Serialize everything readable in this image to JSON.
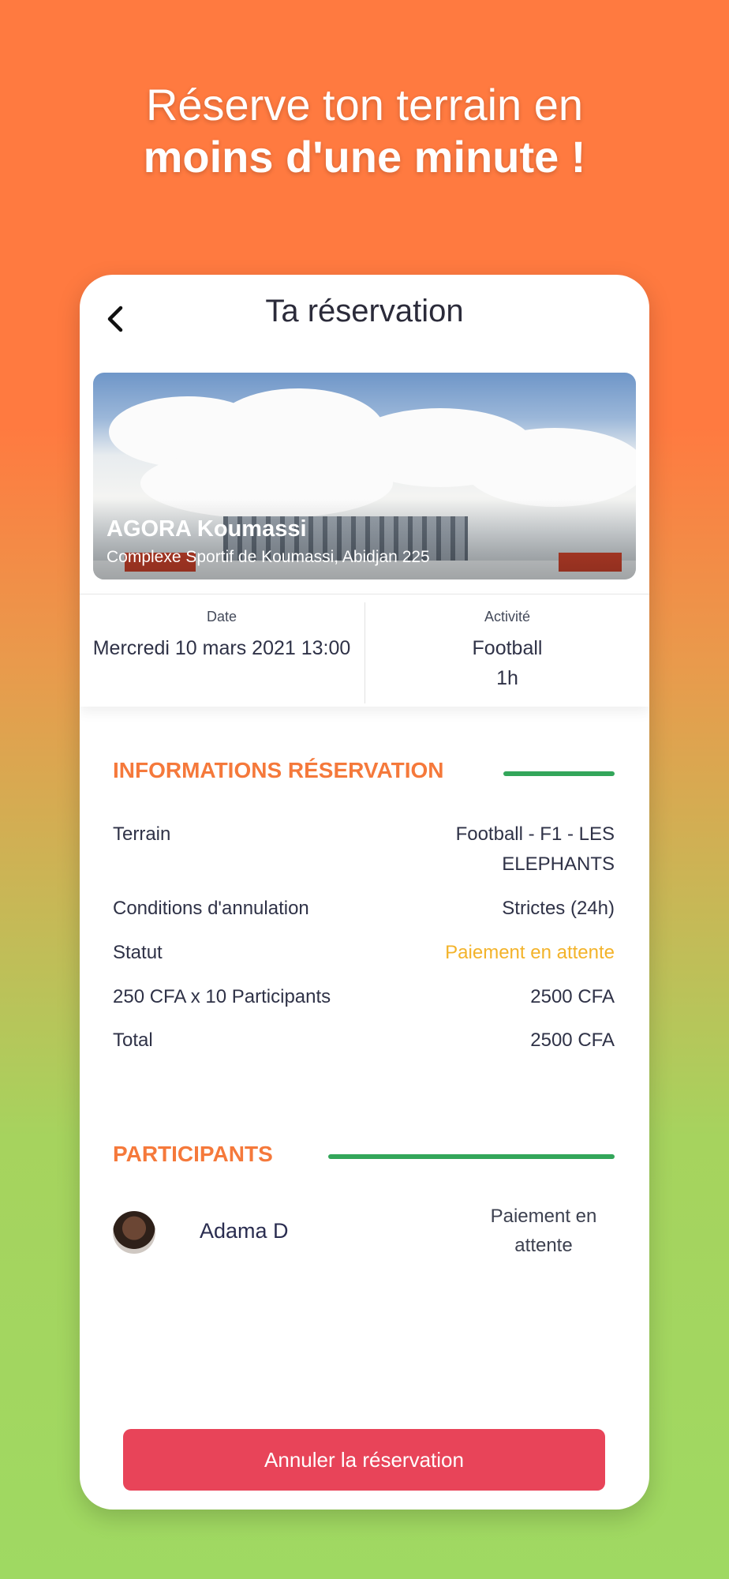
{
  "promo": {
    "line1": "Réserve ton terrain en",
    "line2": "moins d'une minute !"
  },
  "header": {
    "title": "Ta réservation",
    "back_icon": "chevron-left-icon"
  },
  "venue": {
    "name": "AGORA Koumassi",
    "address": "Complexe Sportif de Koumassi, Abidjan 225"
  },
  "summary": {
    "date_label": "Date",
    "date_value": "Mercredi 10 mars 2021 13:00",
    "activity_label": "Activité",
    "activity_value": "Football",
    "duration_value": "1h"
  },
  "reservation_info": {
    "heading": "INFORMATIONS RÉSERVATION",
    "rows": [
      {
        "label": "Terrain",
        "value_line1": "Football - F1 - LES",
        "value_line2": "ELEPHANTS"
      },
      {
        "label": "Conditions d'annulation",
        "value": "Strictes (24h)"
      },
      {
        "label": "Statut",
        "value": "Paiement en attente"
      },
      {
        "label": "250 CFA x 10 Participants",
        "value": "2500 CFA"
      },
      {
        "label": "Total",
        "value": "2500 CFA"
      }
    ]
  },
  "participants": {
    "heading": "PARTICIPANTS",
    "items": [
      {
        "name": "Adama D",
        "status_line1": "Paiement en",
        "status_line2": "attente"
      }
    ]
  },
  "actions": {
    "cancel_label": "Annuler la réservation"
  },
  "colors": {
    "accent_orange": "#f5793b",
    "accent_green": "#33a65a",
    "pending_yellow": "#f3b32a",
    "cancel_red": "#e84459"
  }
}
